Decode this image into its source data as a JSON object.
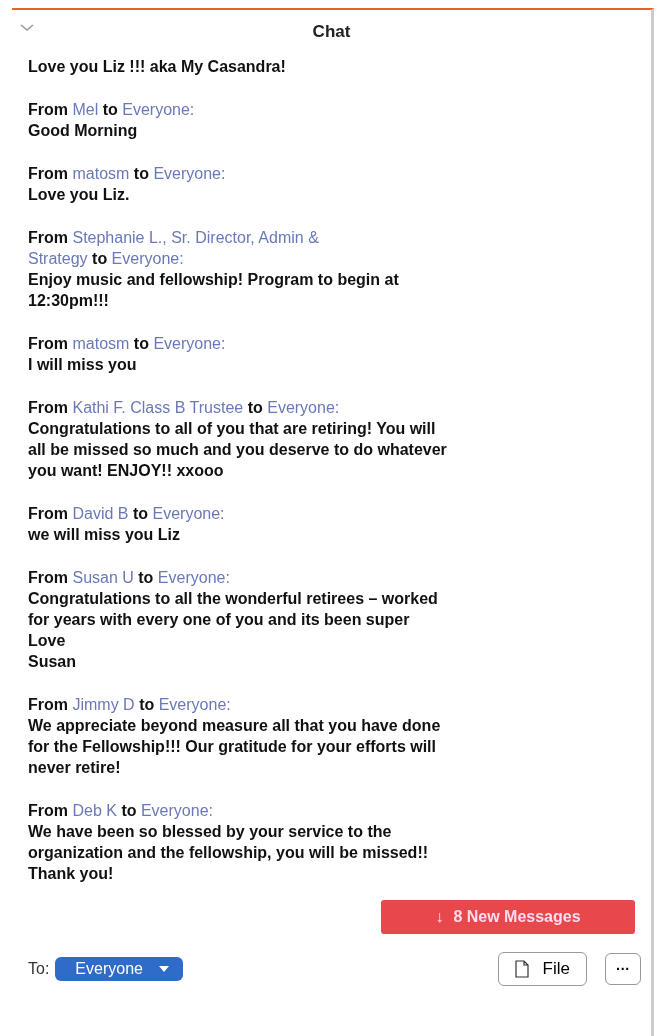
{
  "panel": {
    "title": "Chat"
  },
  "first_text": "Love you Liz !!! aka My Casandra!",
  "messages": [
    {
      "from_label": "From",
      "sender": "Mel",
      "to_label": "to",
      "recipient": "Everyone:",
      "text": "Good Morning"
    },
    {
      "from_label": "From",
      "sender": "matosm",
      "to_label": "to",
      "recipient": "Everyone:",
      "text": "Love you Liz."
    },
    {
      "from_label": "From",
      "sender": "Stephanie L., Sr. Director, Admin &\nStrategy",
      "to_label": "to",
      "recipient": "Everyone:",
      "text": "Enjoy music and fellowship! Program to begin at\n12:30pm!!!"
    },
    {
      "from_label": "From",
      "sender": "matosm",
      "to_label": "to",
      "recipient": "Everyone:",
      "text": "I will miss you"
    },
    {
      "from_label": "From",
      "sender": "Kathi F. Class B Trustee",
      "to_label": "to",
      "recipient": "Everyone:",
      "text": "Congratulations to all of you that are retiring! You will\nall be missed so much and you deserve to do whatever\nyou want! ENJOY!! xxooo"
    },
    {
      "from_label": "From",
      "sender": "David B",
      "to_label": "to",
      "recipient": "Everyone:",
      "text": "we will miss you Liz"
    },
    {
      "from_label": "From",
      "sender": "Susan U",
      "to_label": "to",
      "recipient": "Everyone:",
      "text": "Congratulations to all the wonderful retirees – worked\nfor years with every one of you and its been super\nLove\nSusan"
    },
    {
      "from_label": "From",
      "sender": "Jimmy D",
      "to_label": "to",
      "recipient": "Everyone:",
      "text": "We appreciate beyond measure all that you have done\nfor the Fellowship!!! Our gratitude for your efforts will\nnever retire!"
    },
    {
      "from_label": "From",
      "sender": "Deb K",
      "to_label": "to",
      "recipient": "Everyone:",
      "text": "We have been so blessed by your service to the\norganization and the fellowship, you will be missed!!\nThank you!"
    }
  ],
  "new_messages": {
    "arrow": "↓",
    "label": "8  New Messages"
  },
  "footer": {
    "to_label": "To:",
    "recipient": "Everyone",
    "file_button": "File",
    "more_button": "···"
  }
}
